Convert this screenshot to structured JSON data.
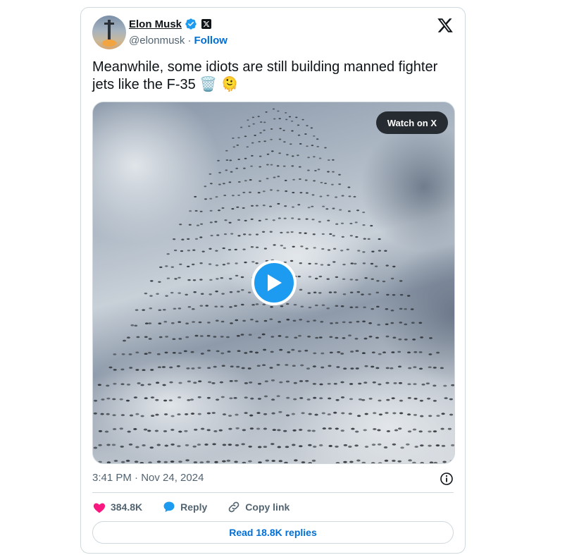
{
  "author": {
    "name": "Elon Musk",
    "handle": "@elonmusk",
    "separator": "·",
    "follow_label": "Follow"
  },
  "tweet": {
    "text": "Meanwhile, some idiots are still building manned fighter jets like the F-35 🗑️ 🫠"
  },
  "media": {
    "watch_label": "Watch on X",
    "play_icon": "play-icon"
  },
  "meta": {
    "timestamp": "3:41 PM · Nov 24, 2024"
  },
  "actions": {
    "like_count": "384.8K",
    "reply_label": "Reply",
    "copy_link_label": "Copy link"
  },
  "footer": {
    "read_replies_label": "Read 18.8K replies"
  },
  "colors": {
    "accent": "#1d9bf0",
    "link": "#006fd6",
    "like": "#f91880",
    "text_primary": "#0f1419",
    "text_secondary": "#536471",
    "border": "#cfd9de"
  }
}
